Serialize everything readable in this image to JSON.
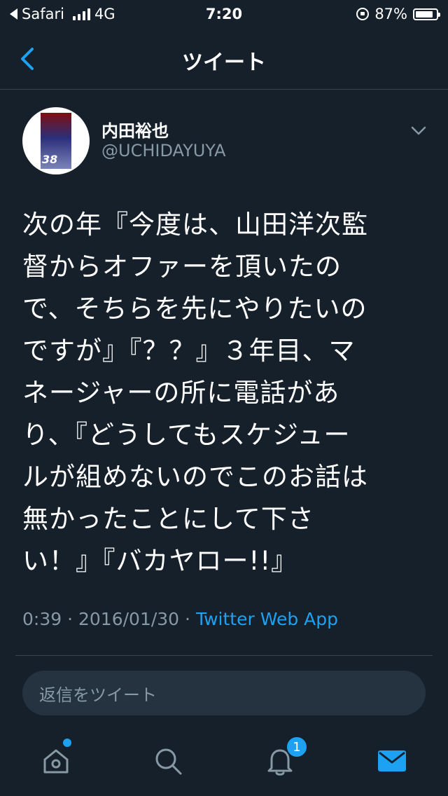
{
  "status_bar": {
    "back_app": "Safari",
    "network": "4G",
    "time": "7:20",
    "battery": "87%",
    "battery_level": 0.87
  },
  "nav": {
    "title": "ツイート"
  },
  "tweet": {
    "author_name": "内田裕也",
    "author_handle": "@UCHIDAYUYA",
    "avatar_text": "38",
    "text": "次の年『今度は、山田洋次監\n督からオファーを頂いたの\nで、そちらを先にやりたいの\nですが』『？？』３年目、マ\nネージャーの所に電話があ\nり、『どうしてもスケジュー\nルが組めないのでこのお話は\n無かったことにして下さ\nい！』『バカヤロー!!』",
    "time": "0:39",
    "date": "2016/01/30",
    "source": "Twitter Web App"
  },
  "reply": {
    "placeholder": "返信をツイート"
  },
  "tab_bar": {
    "notification_count": "1"
  },
  "colors": {
    "background": "#15202b",
    "accent": "#1da1f2",
    "muted": "#8899a6",
    "divider": "#38444d",
    "input_bg": "#253341"
  }
}
